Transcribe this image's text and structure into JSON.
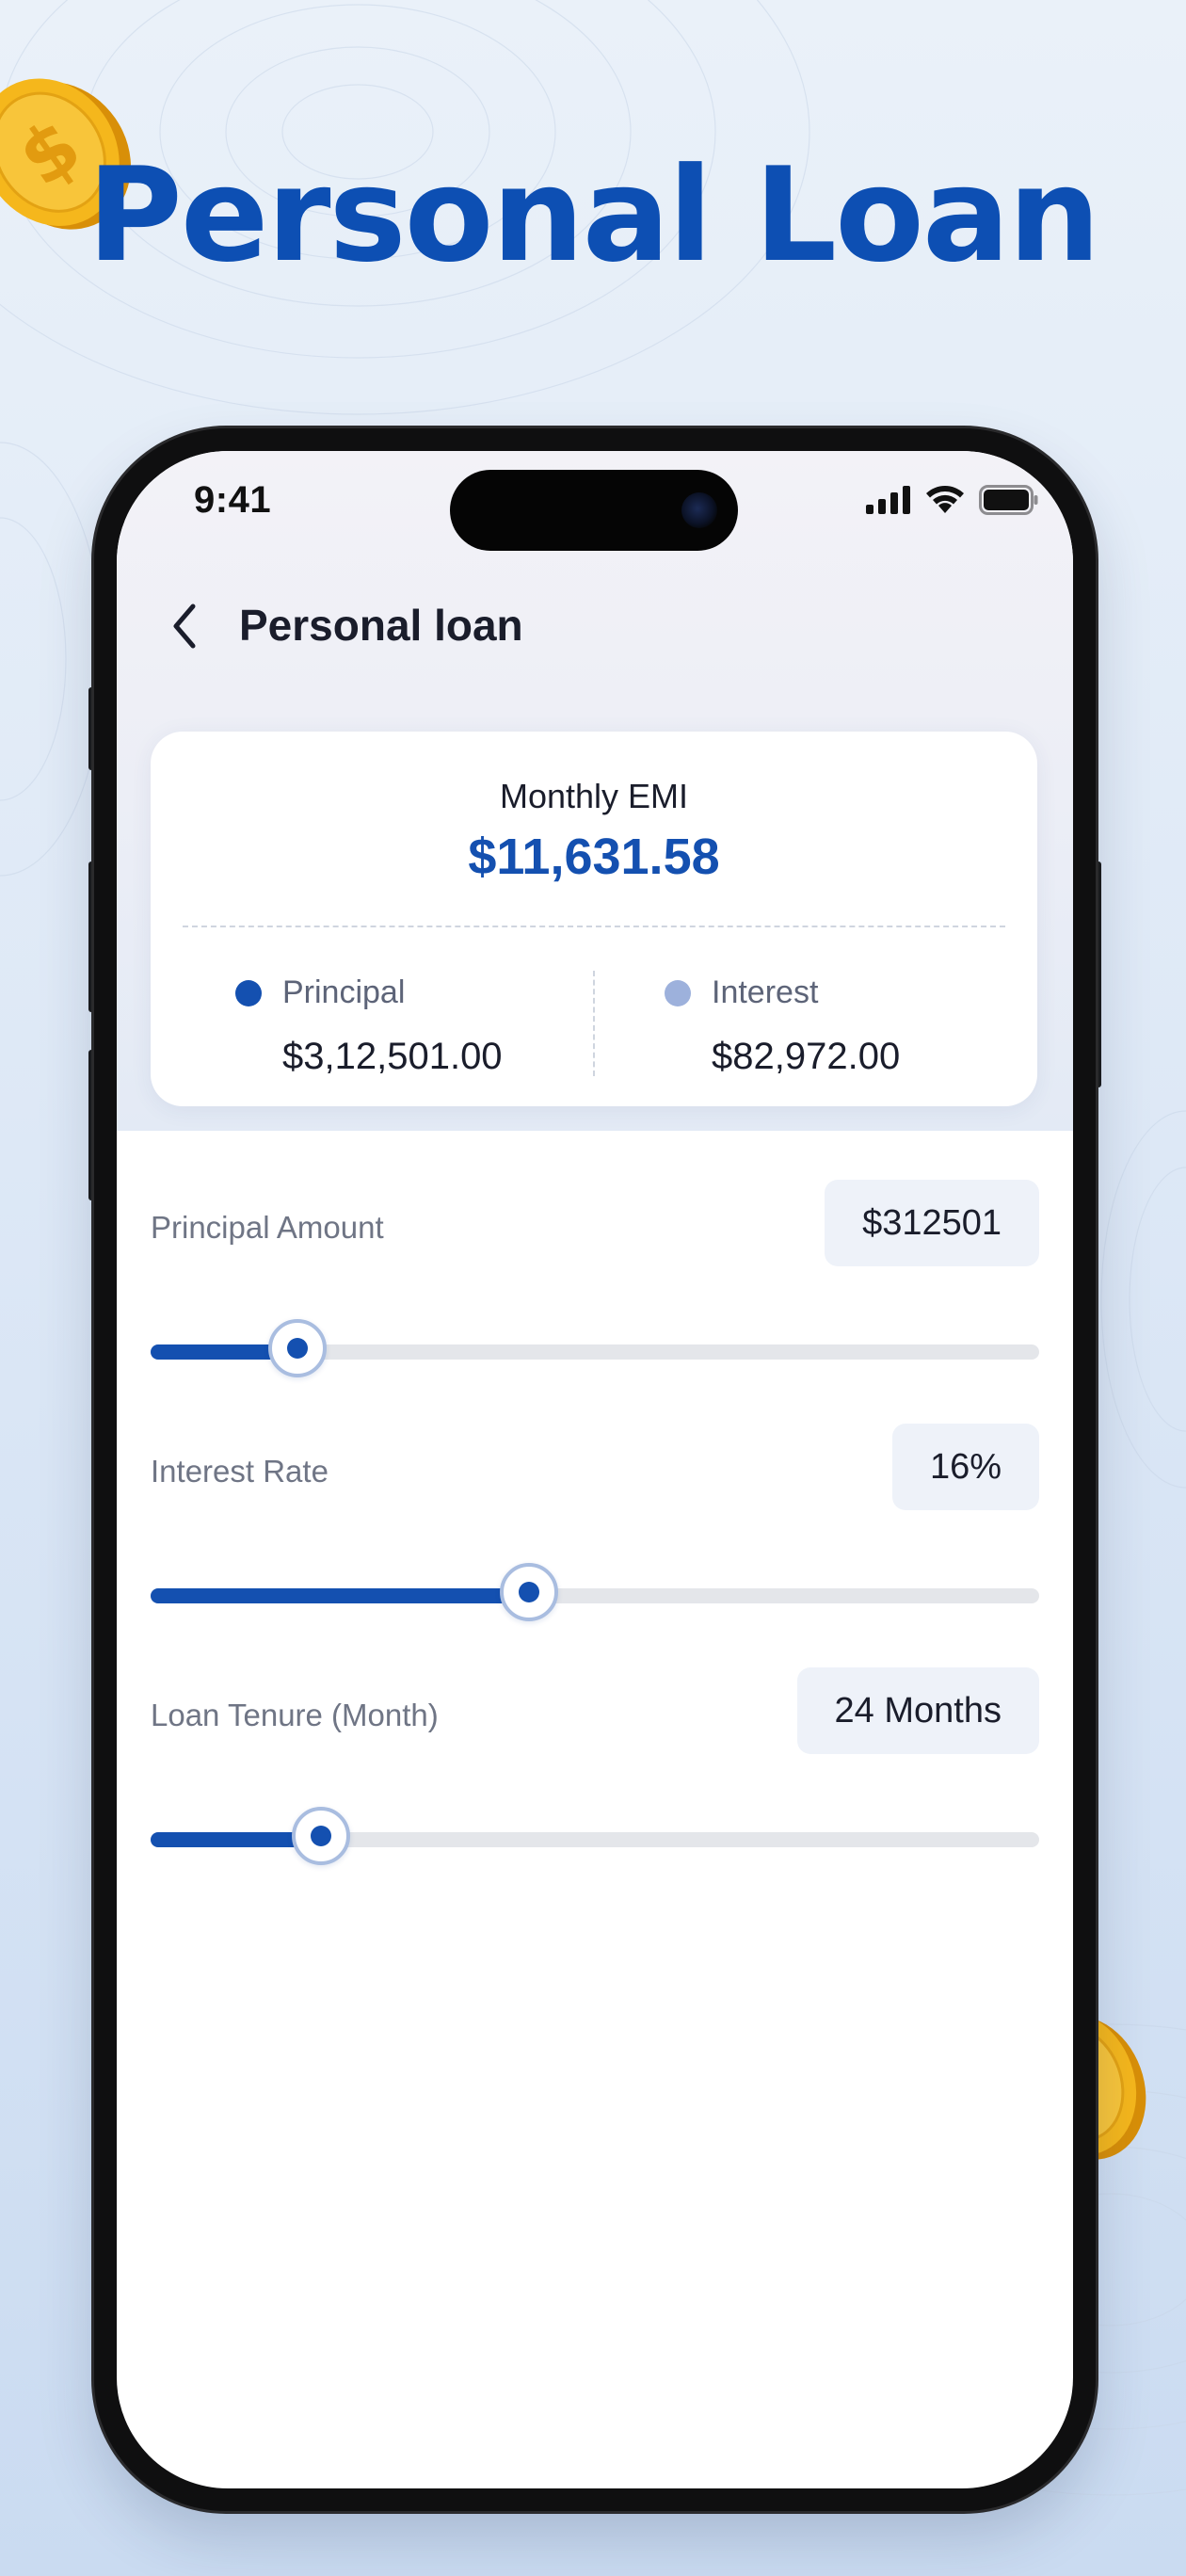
{
  "headline": "Personal Loan",
  "status_bar": {
    "time": "9:41",
    "icons": [
      "signal-icon",
      "wifi-icon",
      "battery-icon"
    ]
  },
  "nav": {
    "back_icon": "chevron-left-icon",
    "title": "Personal loan"
  },
  "summary": {
    "emi_label": "Monthly EMI",
    "emi_value": "$11,631.58",
    "principal": {
      "label": "Principal",
      "value": "$3,12,501.00",
      "color": "#1450b0"
    },
    "interest": {
      "label": "Interest",
      "value": "$82,972.00",
      "color": "#9db1dc"
    }
  },
  "fields": [
    {
      "label": "Principal Amount",
      "value": "$312501",
      "slider_fraction": 0.165
    },
    {
      "label": "Interest Rate",
      "value": "16%",
      "slider_fraction": 0.426
    },
    {
      "label": "Loan Tenure (Month)",
      "value": "24 Months",
      "slider_fraction": 0.192
    }
  ],
  "colors": {
    "accent": "#1450b0",
    "headline": "#0d4fb3",
    "coin": "#f5b71c"
  }
}
